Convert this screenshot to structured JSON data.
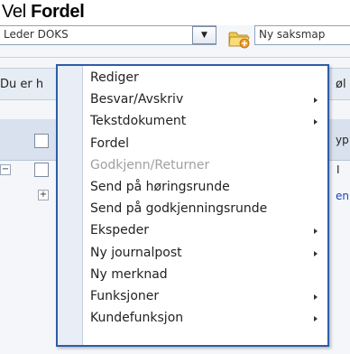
{
  "caption": {
    "prefix": "Vel ",
    "bold": "Fordel"
  },
  "toolbar": {
    "role_value": "Leder DOKS",
    "dropdown_glyph": "▼",
    "new_case_label": "Ny saksmap"
  },
  "panel": {
    "left_text": "Du er h",
    "right_text": "øl"
  },
  "grid": {
    "header_right": "yp",
    "row1": {
      "collapse_glyph": "−",
      "right_text": "I"
    },
    "row2": {
      "expand_glyph": "+",
      "right_text": "en"
    }
  },
  "context_menu": {
    "items": [
      {
        "label": "Rediger",
        "submenu": false,
        "disabled": false
      },
      {
        "label": "Besvar/Avskriv",
        "submenu": true,
        "disabled": false
      },
      {
        "label": "Tekstdokument",
        "submenu": true,
        "disabled": false
      },
      {
        "label": "Fordel",
        "submenu": false,
        "disabled": false
      },
      {
        "label": "Godkjenn/Returner",
        "submenu": false,
        "disabled": true
      },
      {
        "label": "Send på høringsrunde",
        "submenu": false,
        "disabled": false
      },
      {
        "label": "Send på godkjenningsrunde",
        "submenu": false,
        "disabled": false
      },
      {
        "label": "Ekspeder",
        "submenu": true,
        "disabled": false
      },
      {
        "label": "Ny journalpost",
        "submenu": true,
        "disabled": false
      },
      {
        "label": "Ny merknad",
        "submenu": false,
        "disabled": false
      },
      {
        "label": "Funksjoner",
        "submenu": true,
        "disabled": false
      },
      {
        "label": "Kundefunksjon",
        "submenu": true,
        "disabled": false
      }
    ]
  },
  "colors": {
    "menu_border": "#2f5ca8",
    "menu_gutter": "#e9eef6",
    "disabled_text": "#a0a0a0",
    "link_blue": "#1a44b8"
  }
}
